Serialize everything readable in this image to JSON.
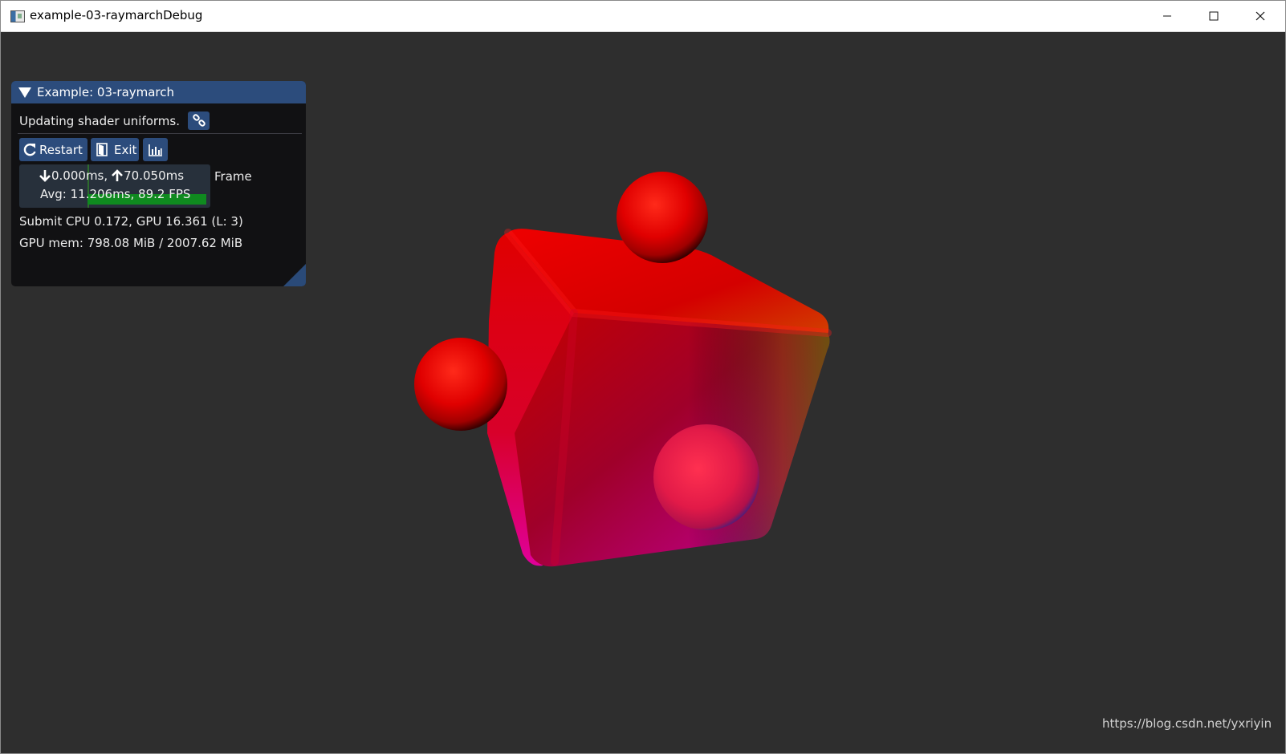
{
  "window": {
    "title": "example-03-raymarchDebug"
  },
  "panel": {
    "title": "Example: 03-raymarch",
    "description": "Updating shader uniforms.",
    "buttons": {
      "restart_label": "Restart",
      "exit_label": "Exit"
    },
    "frame": {
      "min_time": "0.000ms,",
      "max_time": "70.050ms",
      "avg_line": "Avg: 11.206ms, 89.2 FPS",
      "label": "Frame",
      "bar_fill_fraction": 0.66
    },
    "submit_stats": "Submit CPU 0.172, GPU 16.361 (L: 3)",
    "gpu_memory": "GPU mem: 798.08 MiB / 2007.62 MiB"
  },
  "watermark": "https://blog.csdn.net/yxriyin",
  "icons": {
    "app": "app-window-icon",
    "minimize": "minimize-icon",
    "maximize": "maximize-icon",
    "close": "close-icon",
    "collapse": "triangle-down-icon",
    "link": "link-icon",
    "restart": "refresh-icon",
    "exit": "door-exit-icon",
    "stats": "bar-chart-icon",
    "min_arrow": "arrow-down-icon",
    "max_arrow": "arrow-up-icon"
  },
  "colors": {
    "viewport_bg": "#2e2e2e",
    "panel_bg": "#111113",
    "accent": "#2c4c7c",
    "frame_bar": "#0f8a1f"
  }
}
